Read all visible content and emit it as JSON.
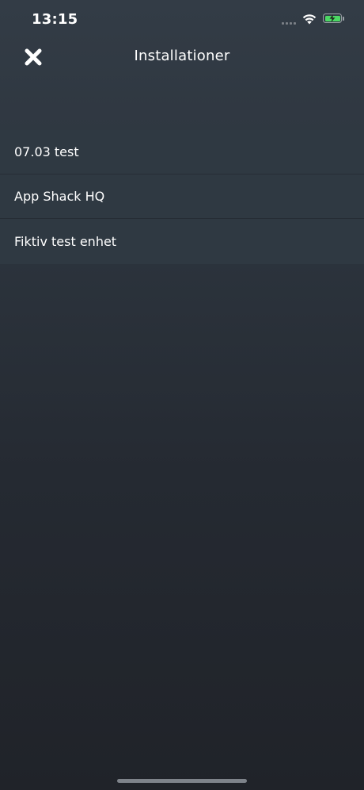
{
  "status_bar": {
    "time": "13:15",
    "icons": [
      "cellular-signal-icon",
      "wifi-icon",
      "battery-charging-icon"
    ],
    "battery_color": "#4cd964"
  },
  "nav": {
    "close_icon": "close-icon",
    "title": "Installationer"
  },
  "installations": [
    {
      "label": "07.03 test"
    },
    {
      "label": "App Shack HQ"
    },
    {
      "label": "Fiktiv test enhet"
    }
  ],
  "colors": {
    "background_top": "#333c46",
    "background_bottom": "#202329",
    "row_background": "#2f3942",
    "text": "#ffffff"
  }
}
